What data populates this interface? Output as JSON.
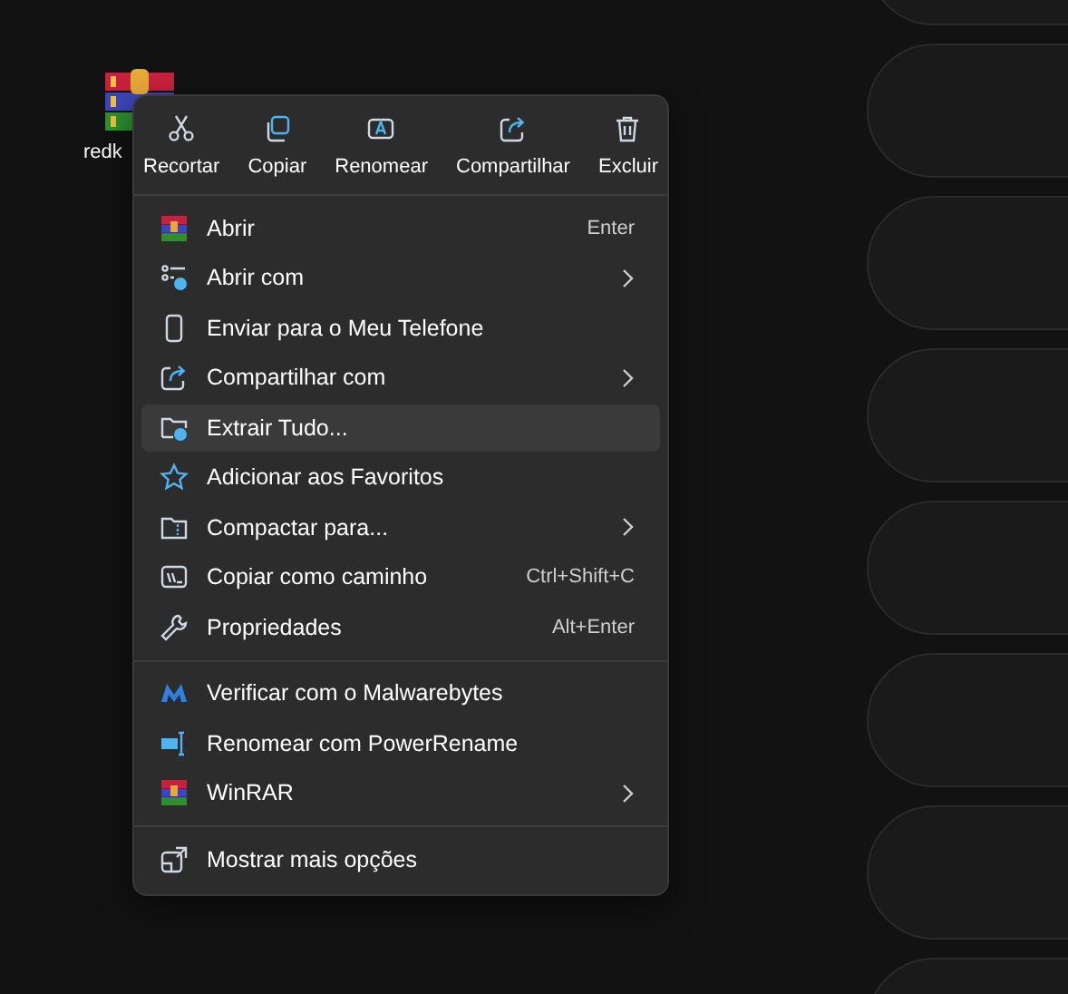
{
  "desktop_icon": {
    "label": "redk"
  },
  "context_menu": {
    "actions": [
      {
        "label": "Recortar"
      },
      {
        "label": "Copiar"
      },
      {
        "label": "Renomear"
      },
      {
        "label": "Compartilhar"
      },
      {
        "label": "Excluir"
      }
    ],
    "groups": [
      [
        {
          "label": "Abrir",
          "shortcut": "Enter",
          "submenu": false,
          "selected": false
        },
        {
          "label": "Abrir com",
          "submenu": true,
          "selected": false
        },
        {
          "label": "Enviar para o Meu Telefone",
          "submenu": false,
          "selected": false
        },
        {
          "label": "Compartilhar com",
          "submenu": true,
          "selected": false
        },
        {
          "label": "Extrair Tudo...",
          "submenu": false,
          "selected": true
        },
        {
          "label": "Adicionar aos Favoritos",
          "submenu": false,
          "selected": false
        },
        {
          "label": "Compactar para...",
          "submenu": true,
          "selected": false
        },
        {
          "label": "Copiar como caminho",
          "shortcut": "Ctrl+Shift+C",
          "submenu": false,
          "selected": false
        },
        {
          "label": "Propriedades",
          "shortcut": "Alt+Enter",
          "submenu": false,
          "selected": false
        }
      ],
      [
        {
          "label": "Verificar com o Malwarebytes",
          "submenu": false,
          "selected": false
        },
        {
          "label": "Renomear com PowerRename",
          "submenu": false,
          "selected": false
        },
        {
          "label": "WinRAR",
          "submenu": true,
          "selected": false
        }
      ],
      [
        {
          "label": "Mostrar mais opções",
          "submenu": false,
          "selected": false
        }
      ]
    ]
  }
}
